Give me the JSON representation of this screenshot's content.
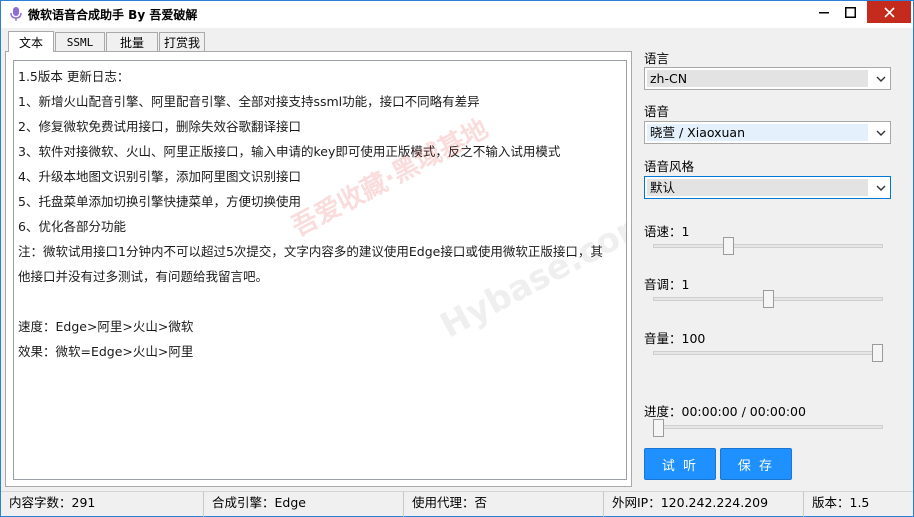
{
  "window": {
    "title": "微软语音合成助手 By 吾爱破解"
  },
  "tabs": [
    {
      "label": "文本"
    },
    {
      "label": "SSML"
    },
    {
      "label": "批量"
    },
    {
      "label": "打赏我"
    }
  ],
  "editor": {
    "lines": [
      "1.5版本 更新日志：",
      "1、新增火山配音引擎、阿里配音引擎、全部对接支持ssml功能，接口不同略有差异",
      "2、修复微软免费试用接口，删除失效谷歌翻译接口",
      "3、软件对接微软、火山、阿里正版接口，输入申请的key即可使用正版模式，反之不输入试用模式",
      "4、升级本地图文识别引擎，添加阿里图文识别接口",
      "5、托盘菜单添加切换引擎快捷菜单，方便切换使用",
      "6、优化各部分功能",
      "注：微软试用接口1分钟内不可以超过5次提交，文字内容多的建议使用Edge接口或使用微软正版接口，其",
      "他接口并没有过多测试，有问题给我留言吧。",
      "",
      "速度：Edge>阿里>火山>微软",
      "效果：微软=Edge>火山>阿里"
    ],
    "watermark_1": "吾爱收藏·黑域基地",
    "watermark_2": "Hybase.com"
  },
  "right_panel": {
    "language_label": "语言",
    "language_value": "zh-CN",
    "voice_label": "语音",
    "voice_value": "晓萱 / Xiaoxuan",
    "style_label": "语音风格",
    "style_value": "默认",
    "speed_label": "语速：1",
    "speed_level": 0.32,
    "pitch_label": "音调：1",
    "pitch_level": 0.5,
    "volume_label": "音量：100",
    "volume_level": 1.0,
    "progress_label": "进度：00:00:00 / 00:00:00",
    "progress_level": 0.0,
    "listen_button": "试 听",
    "save_button": "保 存"
  },
  "status_bar": {
    "char_count": "内容字数：291",
    "engine": "合成引擎：Edge",
    "proxy": "使用代理：否",
    "ip": "外网IP：120.242.224.209",
    "version": "版本：1.5"
  },
  "colors": {
    "accent": "#1e90ff",
    "close_button": "#c42b1c",
    "window_border": "#2b7fd4"
  }
}
